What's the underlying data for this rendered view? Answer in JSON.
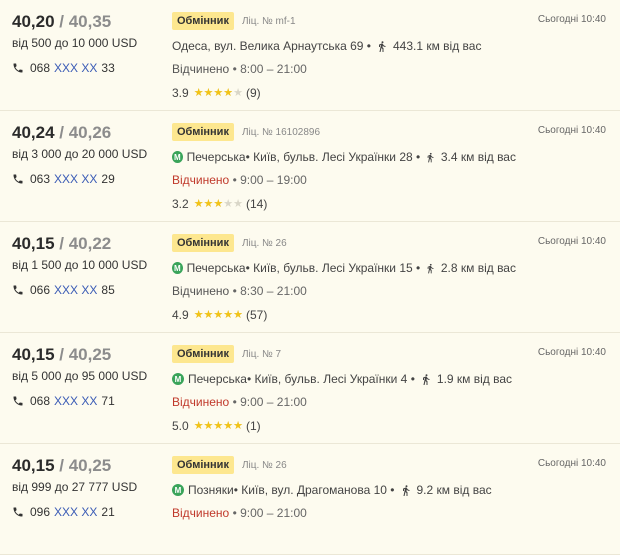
{
  "labels": {
    "badge": "Обмінник",
    "stars": "★★★★★"
  },
  "offers": [
    {
      "buy": "40,20",
      "sell": "40,35",
      "range": "від 500 до 10 000 USD",
      "phone_prefix": "068",
      "phone_masked": "XXX XX",
      "phone_suffix": "33",
      "license": "Ліц. № mf-1",
      "metro": "",
      "address": "Одеса, вул. Велика Арнаутська 69 •",
      "distance": "443.1 км від вас",
      "status": "Відчинено",
      "status_closed": false,
      "hours": " • 8:00 – 21:00",
      "rating": "3.9",
      "rating_value": 3.9,
      "reviews": "(9)",
      "updated": "Сьогодні 10:40"
    },
    {
      "buy": "40,24",
      "sell": "40,26",
      "range": "від 3 000 до 20 000 USD",
      "phone_prefix": "063",
      "phone_masked": "XXX XX",
      "phone_suffix": "29",
      "license": "Ліц. № 16102896",
      "metro": "Печерська",
      "address": " • Київ, бульв. Лесі Українки 28 •",
      "distance": "3.4 км від вас",
      "status": "Відчинено",
      "status_closed": true,
      "hours": " • 9:00 – 19:00",
      "rating": "3.2",
      "rating_value": 3.2,
      "reviews": "(14)",
      "updated": "Сьогодні 10:40"
    },
    {
      "buy": "40,15",
      "sell": "40,22",
      "range": "від 1 500 до 10 000 USD",
      "phone_prefix": "066",
      "phone_masked": "XXX XX",
      "phone_suffix": "85",
      "license": "Ліц. № 26",
      "metro": "Печерська",
      "address": " • Київ, бульв. Лесі Українки 15 •",
      "distance": "2.8 км від вас",
      "status": "Відчинено",
      "status_closed": false,
      "hours": " • 8:30 – 21:00",
      "rating": "4.9",
      "rating_value": 4.9,
      "reviews": "(57)",
      "updated": "Сьогодні 10:40"
    },
    {
      "buy": "40,15",
      "sell": "40,25",
      "range": "від 5 000 до 95 000 USD",
      "phone_prefix": "068",
      "phone_masked": "XXX XX",
      "phone_suffix": "71",
      "license": "Ліц. № 7",
      "metro": "Печерська",
      "address": " • Київ, бульв. Лесі Українки 4 •",
      "distance": "1.9 км від вас",
      "status": "Відчинено",
      "status_closed": true,
      "hours": " • 9:00 – 21:00",
      "rating": "5.0",
      "rating_value": 5.0,
      "reviews": "(1)",
      "updated": "Сьогодні 10:40"
    },
    {
      "buy": "40,15",
      "sell": "40,25",
      "range": "від 999 до 27 777 USD",
      "phone_prefix": "096",
      "phone_masked": "XXX XX",
      "phone_suffix": "21",
      "license": "Ліц. № 26",
      "metro": "Позняки",
      "address": " • Київ, вул. Драгоманова 10 •",
      "distance": "9.2 км від вас",
      "status": "Відчинено",
      "status_closed": true,
      "hours": " • 9:00 – 21:00",
      "rating": "",
      "rating_value": null,
      "reviews": "",
      "updated": "Сьогодні 10:40"
    }
  ],
  "colors": {
    "background": "#fdfbef",
    "badge": "#fde78f",
    "closed": "#c0392b",
    "link": "#3a5bb5",
    "metro": "#3aa45a",
    "star": "#f2c316"
  }
}
